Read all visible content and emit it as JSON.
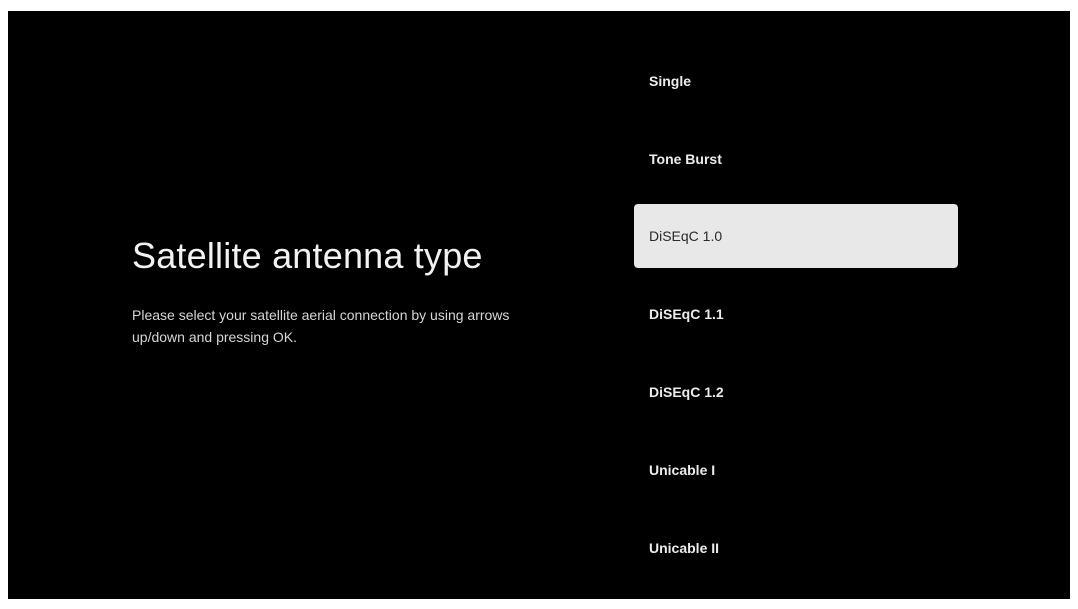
{
  "page": {
    "title": "Satellite antenna type",
    "description": "Please select your satellite aerial connection by using arrows up/down and pressing OK."
  },
  "menu": {
    "selected_index": 2,
    "items": [
      {
        "label": "Single"
      },
      {
        "label": "Tone Burst"
      },
      {
        "label": "DiSEqC 1.0"
      },
      {
        "label": "DiSEqC 1.1"
      },
      {
        "label": "DiSEqC 1.2"
      },
      {
        "label": "Unicable I"
      },
      {
        "label": "Unicable II"
      }
    ]
  },
  "colors": {
    "background": "#000000",
    "selected_background": "#e8e8e8",
    "selected_text": "#2a2a2a",
    "text": "#ececec"
  }
}
